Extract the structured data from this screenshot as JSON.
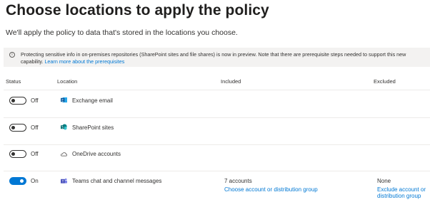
{
  "page": {
    "title": "Choose locations to apply the policy",
    "subtitle": "We'll apply the policy to data that's stored in the locations you choose."
  },
  "banner": {
    "icon": "info-icon",
    "text": "Protecting sensitive info in on-premises repositories (SharePoint sites and file shares) is now in preview. Note that there are prerequisite steps needed to support this new capability.",
    "link": "Learn more about the prerequisites"
  },
  "columns": {
    "status": "Status",
    "location": "Location",
    "included": "Included",
    "excluded": "Excluded"
  },
  "rows": [
    {
      "toggle_on": false,
      "status_label": "Off",
      "icon": "exchange-icon",
      "location": "Exchange email"
    },
    {
      "toggle_on": false,
      "status_label": "Off",
      "icon": "sharepoint-icon",
      "location": "SharePoint sites"
    },
    {
      "toggle_on": false,
      "status_label": "Off",
      "icon": "onedrive-icon",
      "location": "OneDrive accounts"
    },
    {
      "toggle_on": true,
      "status_label": "On",
      "icon": "teams-icon",
      "location": "Teams chat and channel messages",
      "included_count": "7 accounts",
      "included_link": "Choose account or distribution group",
      "excluded_value": "None",
      "excluded_link": "Exclude account or distribution group"
    }
  ],
  "colors": {
    "accent": "#0078d4",
    "banner_bg": "#f3f2f1",
    "divider": "#edebe9"
  }
}
